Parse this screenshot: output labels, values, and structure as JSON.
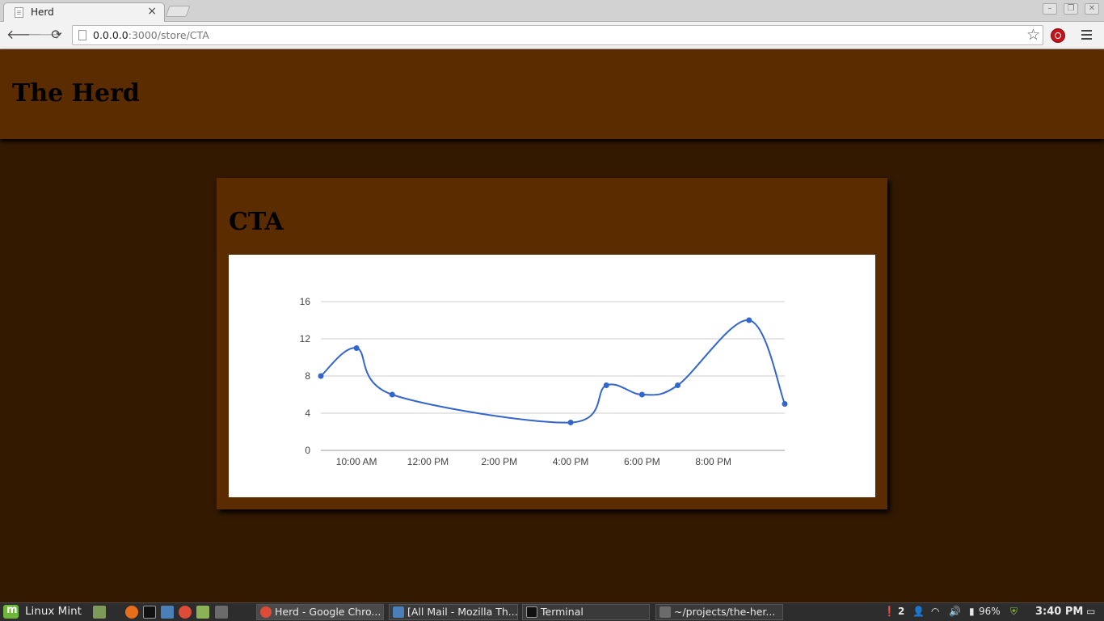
{
  "browser": {
    "tab_title": "Herd",
    "tab_close": "×",
    "url_host": "0.0.0.0",
    "url_rest": ":3000/store/CTA"
  },
  "page": {
    "site_title": "The Herd",
    "card_title": "CTA"
  },
  "chart_data": {
    "type": "line",
    "x": [
      "9:00 AM",
      "10:00 AM",
      "11:00 AM",
      "4:00 PM",
      "5:00 PM",
      "6:00 PM",
      "7:00 PM",
      "9:00 PM",
      "10:00 PM"
    ],
    "x_hours": [
      9,
      10,
      11,
      16,
      17,
      18,
      19,
      21,
      22
    ],
    "values": [
      8,
      11,
      6,
      3,
      7,
      6,
      7,
      14,
      5
    ],
    "xticks": [
      "10:00 AM",
      "12:00 PM",
      "2:00 PM",
      "4:00 PM",
      "6:00 PM",
      "8:00 PM"
    ],
    "xtick_hours": [
      10,
      12,
      14,
      16,
      18,
      20
    ],
    "xlim": [
      9,
      22
    ],
    "ylim": [
      0,
      16
    ],
    "yticks": [
      0,
      4,
      8,
      12,
      16
    ],
    "line_color": "#3366cc",
    "grid": true,
    "legend": "none",
    "smooth": true
  },
  "taskbar": {
    "start_label": "Linux Mint",
    "tasks": [
      "Herd - Google Chro...",
      "[All Mail - Mozilla Th...",
      "Terminal",
      "~/projects/the-her..."
    ],
    "notifications": "2",
    "battery": "96%",
    "clock": "3:40 PM"
  },
  "colors": {
    "header_bg": "#5a2c00",
    "page_bg": "#331900",
    "chart_line": "#3366cc"
  }
}
